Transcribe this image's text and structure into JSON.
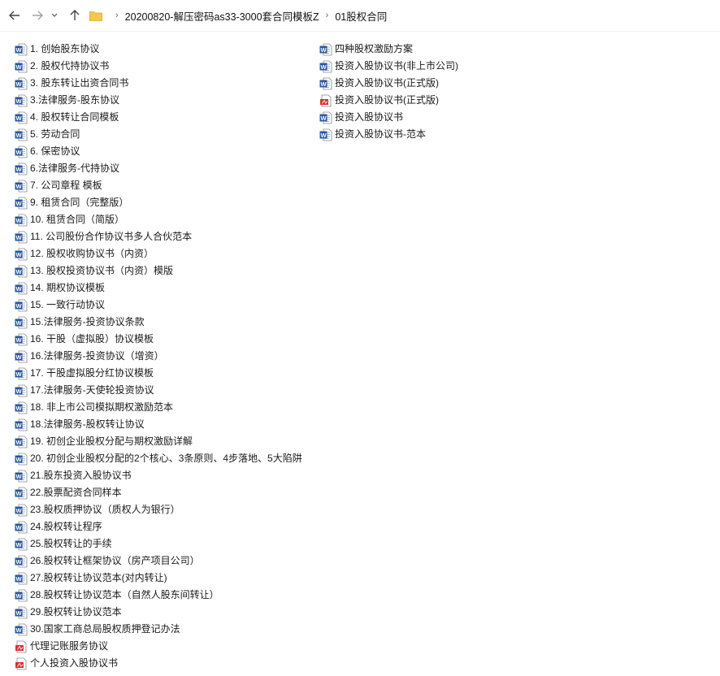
{
  "nav": {
    "back": "back-arrow-icon",
    "forward": "forward-arrow-icon",
    "recent": "chevron-down-icon",
    "up": "up-arrow-icon"
  },
  "breadcrumb": {
    "separator": "›",
    "parts": [
      "20200820-解压密码as33-3000套合同模板Z",
      "01股权合同"
    ]
  },
  "colors": {
    "word_blue": "#2b579a",
    "pdf_red": "#d9302c",
    "folder_yellow": "#f5c84c"
  },
  "files": {
    "col1": [
      {
        "label": "1. 创始股东协议",
        "type": "word"
      },
      {
        "label": "2. 股权代持协议书",
        "type": "word"
      },
      {
        "label": "3. 股东转让出资合同书",
        "type": "word"
      },
      {
        "label": "3.法律服务-股东协议",
        "type": "word"
      },
      {
        "label": "4. 股权转让合同模板",
        "type": "word"
      },
      {
        "label": "5. 劳动合同",
        "type": "word"
      },
      {
        "label": "6. 保密协议",
        "type": "word"
      },
      {
        "label": "6.法律服务-代持协议",
        "type": "word"
      },
      {
        "label": "7. 公司章程 模板",
        "type": "word"
      },
      {
        "label": "9. 租赁合同（完整版）",
        "type": "word"
      },
      {
        "label": "10. 租赁合同（简版）",
        "type": "word"
      },
      {
        "label": "11. 公司股份合作协议书多人合伙范本",
        "type": "word"
      },
      {
        "label": "12. 股权收购协议书（内资）",
        "type": "word"
      },
      {
        "label": "13. 股权投资协议书（内资）模版",
        "type": "word"
      },
      {
        "label": "14. 期权协议模板",
        "type": "word"
      },
      {
        "label": "15. 一致行动协议",
        "type": "word"
      },
      {
        "label": "15.法律服务-投资协议条款",
        "type": "word"
      },
      {
        "label": "16. 干股（虚拟股）协议模板",
        "type": "word"
      },
      {
        "label": "16.法律服务-投资协议（增资）",
        "type": "word"
      },
      {
        "label": "17. 干股虚拟股分红协议模板",
        "type": "word"
      },
      {
        "label": "17.法律服务-天使轮投资协议",
        "type": "word"
      },
      {
        "label": "18. 非上市公司模拟期权激励范本",
        "type": "word"
      },
      {
        "label": "18.法律服务-股权转让协议",
        "type": "word"
      },
      {
        "label": "19. 初创企业股权分配与期权激励详解",
        "type": "word"
      },
      {
        "label": "20. 初创企业股权分配的2个核心、3条原则、4步落地、5大陷阱",
        "type": "word"
      },
      {
        "label": "21.股东投资入股协议书",
        "type": "word"
      },
      {
        "label": "22.股票配资合同样本",
        "type": "word"
      },
      {
        "label": "23.股权质押协议（质权人为银行）",
        "type": "word"
      },
      {
        "label": "24.股权转让程序",
        "type": "word"
      },
      {
        "label": "25.股权转让的手续",
        "type": "word"
      },
      {
        "label": "26.股权转让框架协议（房产项目公司）",
        "type": "word"
      },
      {
        "label": "27.股权转让协议范本(对内转让)",
        "type": "word"
      },
      {
        "label": "28.股权转让协议范本（自然人股东间转让）",
        "type": "word"
      },
      {
        "label": "29.股权转让协议范本",
        "type": "word"
      },
      {
        "label": "30.国家工商总局股权质押登记办法",
        "type": "word"
      },
      {
        "label": "代理记账服务协议",
        "type": "pdf"
      },
      {
        "label": "个人投资入股协议书",
        "type": "pdf"
      }
    ],
    "col2": [
      {
        "label": "四种股权激励方案",
        "type": "word"
      },
      {
        "label": "投资入股协议书(非上市公司)",
        "type": "word"
      },
      {
        "label": "投资入股协议书(正式版)",
        "type": "word"
      },
      {
        "label": "投资入股协议书(正式版)",
        "type": "pdf"
      },
      {
        "label": "投资入股协议书",
        "type": "word"
      },
      {
        "label": "投资入股协议书-范本",
        "type": "word"
      }
    ]
  }
}
